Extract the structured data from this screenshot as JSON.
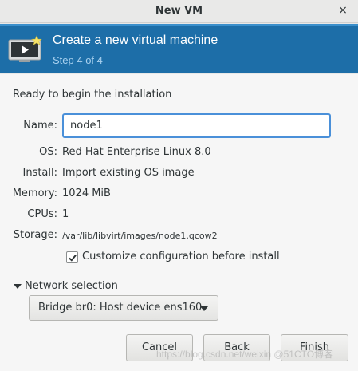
{
  "window": {
    "title": "New VM",
    "close_glyph": "×"
  },
  "banner": {
    "title": "Create a new virtual machine",
    "subtitle": "Step 4 of 4",
    "icon": "vm-monitor-icon",
    "background_color": "#1d6ea8"
  },
  "summary": {
    "heading": "Ready to begin the installation",
    "name_label": "Name:",
    "name_value": "node1",
    "os_label": "OS:",
    "os_value": "Red Hat Enterprise Linux 8.0",
    "install_label": "Install:",
    "install_value": "Import existing OS image",
    "memory_label": "Memory:",
    "memory_value": "1024 MiB",
    "cpus_label": "CPUs:",
    "cpus_value": "1",
    "storage_label": "Storage:",
    "storage_value": "/var/lib/libvirt/images/node1.qcow2"
  },
  "customize": {
    "label": "Customize configuration before install",
    "checked": true
  },
  "network": {
    "expander_label": "Network selection",
    "selected": "Bridge br0: Host device ens160"
  },
  "buttons": {
    "cancel": "Cancel",
    "back": "Back",
    "finish": "Finish"
  },
  "watermark": "https://blog.csdn.net/weixin @51CTO博客"
}
